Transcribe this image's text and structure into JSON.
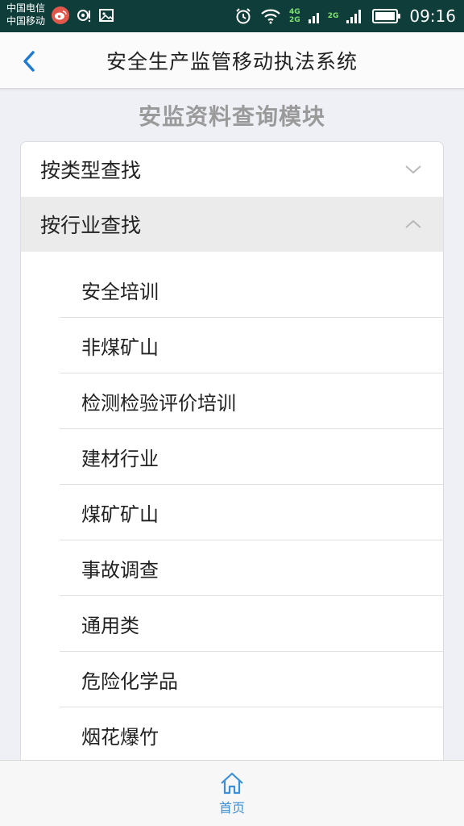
{
  "status_bar": {
    "carrier_1": "中国电信",
    "carrier_2": "中国移动",
    "network_1": "4G",
    "network_2": "2G",
    "network_3": "2G",
    "time": "09:16",
    "icons": [
      "weibo-icon",
      "location-eye-icon",
      "image-icon",
      "alarm-icon",
      "wifi-icon",
      "signal-icon",
      "battery-icon"
    ]
  },
  "header": {
    "title": "安全生产监管移动执法系统",
    "back_icon": "chevron-left-icon"
  },
  "module": {
    "title": "安监资料查询模块"
  },
  "sections": [
    {
      "label": "按类型查找",
      "expanded": false,
      "icon": "chevron-down-icon"
    },
    {
      "label": "按行业查找",
      "expanded": true,
      "icon": "chevron-up-icon"
    }
  ],
  "industry_items": [
    "安全培训",
    "非煤矿山",
    "检测检验评价培训",
    "建材行业",
    "煤矿矿山",
    "事故调查",
    "通用类",
    "危险化学品",
    "烟花爆竹"
  ],
  "bottom_nav": {
    "home_label": "首页",
    "home_icon": "home-icon"
  },
  "colors": {
    "status_bar": "#0e3d3a",
    "accent": "#3a8fd6",
    "back_arrow": "#1f7ad1",
    "background": "#eef0f5",
    "module_title": "#9a9a9a"
  }
}
